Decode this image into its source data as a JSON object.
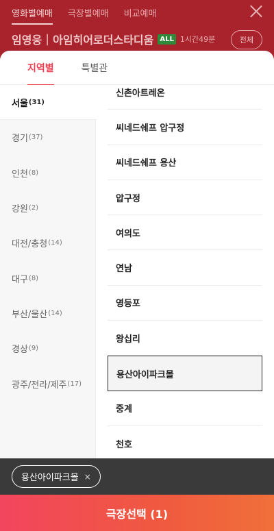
{
  "header": {
    "tabs": [
      {
        "label": "영화별예매",
        "active": true
      },
      {
        "label": "극장별예매",
        "active": false
      },
      {
        "label": "비교예매",
        "active": false
      }
    ],
    "movie_title": "임영웅｜아임히어로더스타디움",
    "rating": "ALL",
    "runtime": "1시간49분",
    "all_button": "전체",
    "close_icon": "close-icon"
  },
  "sheet": {
    "tabs": [
      {
        "label": "지역별",
        "active": true
      },
      {
        "label": "특별관",
        "active": false
      }
    ],
    "regions": [
      {
        "name": "서울",
        "count": "(31)"
      },
      {
        "name": "경기",
        "count": "(37)"
      },
      {
        "name": "인천",
        "count": "(8)"
      },
      {
        "name": "강원",
        "count": "(2)"
      },
      {
        "name": "대전/충청",
        "count": "(14)"
      },
      {
        "name": "대구",
        "count": "(8)"
      },
      {
        "name": "부산/울산",
        "count": "(14)"
      },
      {
        "name": "경상",
        "count": "(9)"
      },
      {
        "name": "광주/전라/제주",
        "count": "(17)"
      }
    ],
    "active_region_index": 0,
    "theaters": [
      "신촌아트레온",
      "씨네드쉐프 압구정",
      "씨네드쉐프 용산",
      "압구정",
      "여의도",
      "연남",
      "영등포",
      "왕십리",
      "용산아이파크몰",
      "중계",
      "천호"
    ],
    "selected_theater_index": 8
  },
  "selection": {
    "chip_label": "용산아이파크몰",
    "chip_remove": "×"
  },
  "confirm_button": "극장선택 (1)"
}
